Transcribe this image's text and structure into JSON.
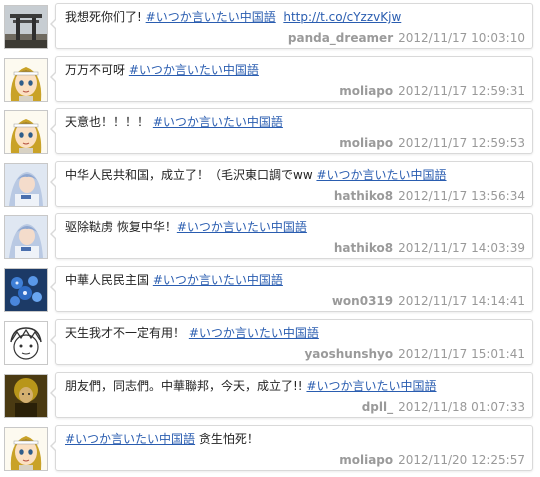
{
  "tweets": [
    {
      "avatar": "temple-gate-avatar",
      "pre": "我想死你们了! ",
      "hashtag": "#いつか言いたい中国語",
      "post": " ",
      "link": "http://t.co/cYzzvKjw",
      "user": "panda_dreamer",
      "time": "2012/11/17 10:03:10"
    },
    {
      "avatar": "anime-girl-avatar",
      "pre": "万万不可呀 ",
      "hashtag": "#いつか言いたい中国語",
      "post": "",
      "link": "",
      "user": "moliapo",
      "time": "2012/11/17 12:59:31"
    },
    {
      "avatar": "anime-girl-avatar",
      "pre": "天意也！！！！ ",
      "hashtag": "#いつか言いたい中国語",
      "post": "",
      "link": "",
      "user": "moliapo",
      "time": "2012/11/17 12:59:53"
    },
    {
      "avatar": "cosplay-avatar",
      "pre": "中华人民共和国，成立了！（毛沢東口調でww ",
      "hashtag": "#いつか言いたい中国語",
      "post": "",
      "link": "",
      "user": "hathiko8",
      "time": "2012/11/17 13:56:34"
    },
    {
      "avatar": "cosplay-avatar",
      "pre": "驱除鞑虏 恢复中华！",
      "hashtag": "#いつか言いたい中国語",
      "post": "",
      "link": "",
      "user": "hathiko8",
      "time": "2012/11/17 14:03:39"
    },
    {
      "avatar": "blue-flowers-avatar",
      "pre": "中華人民民主国 ",
      "hashtag": "#いつか言いたい中国語",
      "post": "",
      "link": "",
      "user": "won0319",
      "time": "2012/11/17 14:14:41"
    },
    {
      "avatar": "sketch-face-avatar",
      "pre": "天生我才不一定有用！ ",
      "hashtag": "#いつか言いたい中国語",
      "post": "",
      "link": "",
      "user": "yaoshunshyo",
      "time": "2012/11/17 15:01:41"
    },
    {
      "avatar": "dark-photo-avatar",
      "pre": "朋友們，同志們。中華聯邦，今天，成立了!! ",
      "hashtag": "#いつか言いたい中国語",
      "post": "",
      "link": "",
      "user": "dpll_",
      "time": "2012/11/18 01:07:33"
    },
    {
      "avatar": "anime-girl-avatar",
      "pre": "",
      "hashtag": "#いつか言いたい中国語",
      "post": " 贪生怕死！",
      "link": "",
      "user": "moliapo",
      "time": "2012/11/20 12:25:57"
    }
  ]
}
